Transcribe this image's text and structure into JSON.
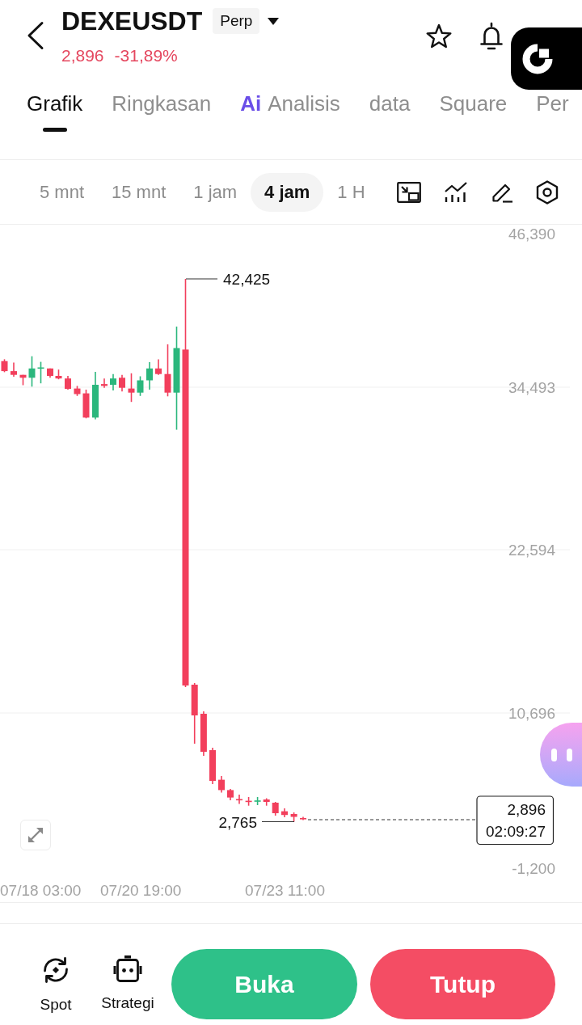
{
  "header": {
    "title": "DEXEUSDT",
    "badge": "Perp",
    "price": "2,896",
    "change": "-31,89%"
  },
  "tabs": [
    {
      "label": "Grafik",
      "selected": true
    },
    {
      "label": "Ringkasan",
      "selected": false
    },
    {
      "prefix": "Ai",
      "label": "Analisis",
      "selected": false
    },
    {
      "label": "data",
      "selected": false
    },
    {
      "label": "Square",
      "selected": false
    },
    {
      "label": "Per",
      "selected": false
    }
  ],
  "timeframes": [
    {
      "label": "5 mnt",
      "selected": false
    },
    {
      "label": "15 mnt",
      "selected": false
    },
    {
      "label": "1 jam",
      "selected": false
    },
    {
      "label": "4 jam",
      "selected": true
    },
    {
      "label": "1 H",
      "selected": false
    }
  ],
  "chart": {
    "y_axis": [
      "46,390",
      "34,493",
      "22,594",
      "10,696",
      "-1,200"
    ],
    "x_axis": [
      "07/18 03:00",
      "07/20 19:00",
      "07/23 11:00"
    ],
    "high": "42,425",
    "low": "2,765",
    "last_price": "2,896",
    "countdown": "02:09:27"
  },
  "bottom_bar": {
    "shortcuts": [
      {
        "label": "Spot"
      },
      {
        "label": "Strategi"
      }
    ],
    "buy_button": "Buka",
    "sell_button": "Tutup"
  }
}
